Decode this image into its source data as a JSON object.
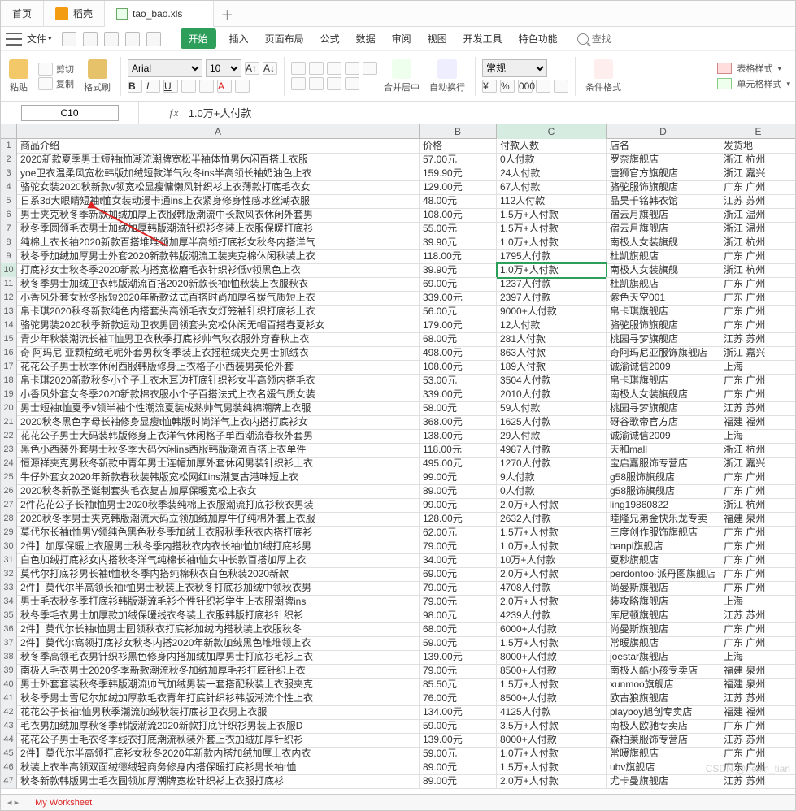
{
  "tabs": [
    {
      "label": "首页",
      "icon": false
    },
    {
      "label": "稻壳",
      "icon": true
    },
    {
      "label": "tao_bao.xls",
      "icon": true
    }
  ],
  "menu": {
    "file": "文件",
    "items": [
      "开始",
      "插入",
      "页面布局",
      "公式",
      "数据",
      "审阅",
      "视图",
      "开发工具",
      "特色功能"
    ],
    "search": "查找"
  },
  "ribbon": {
    "paste": "粘贴",
    "cut": "剪切",
    "copy": "复制",
    "format_painter": "格式刷",
    "font": "Arial",
    "size": "10",
    "merge": "合并居中",
    "wrap": "自动换行",
    "general": "常规",
    "cond_format": "条件格式",
    "table_styles": "表格样式",
    "cell_styles": "单元格样式"
  },
  "namebox": "C10",
  "formula": "1.0万+人付款",
  "cols": [
    "",
    "A",
    "B",
    "C",
    "D",
    "E"
  ],
  "header": [
    "商品介绍",
    "价格",
    "付款人数",
    "店名",
    "发货地"
  ],
  "rows": [
    [
      "2020新款夏季男士短袖t恤潮流潮牌宽松半袖体恤男休闲百搭上衣服",
      "57.00元",
      "0人付款",
      "罗奈旗舰店",
      "浙江 杭州"
    ],
    [
      "yoe卫衣温柔风宽松韩版加绒短款洋气秋冬ins半高领长袖奶油色上衣",
      "159.90元",
      "24人付款",
      "唐狮官方旗舰店",
      "浙江 嘉兴"
    ],
    [
      "骆驼女装2020秋新款v领宽松显瘦慵懒风针织衫上衣薄款打底毛衣女",
      "129.00元",
      "67人付款",
      "骆驼服饰旗舰店",
      "广东 广州"
    ],
    [
      "日系3d大眼睛短袖t恤女装动漫卡通ins上衣紧身修身性感冰丝潮衣服",
      "48.00元",
      "112人付款",
      "品昊千铭韩衣馆",
      "江苏 苏州"
    ],
    [
      "男士夹克秋冬季新款加绒加厚上衣服韩版潮流中长款风衣休闲外套男",
      "108.00元",
      "1.5万+人付款",
      "宿云月旗舰店",
      "浙江 温州"
    ],
    [
      "秋冬季圆领毛衣男士加绒加厚韩版潮流针织衫冬装上衣服保暖打底衫",
      "55.00元",
      "1.5万+人付款",
      "宿云月旗舰店",
      "浙江 温州"
    ],
    [
      "纯棉上衣长袖2020新款百搭堆堆领加厚半高领打底衫女秋冬内搭洋气",
      "39.90元",
      "1.0万+人付款",
      "南极人女装旗舰",
      "浙江 杭州"
    ],
    [
      "秋冬季加绒加厚男士外套2020新款韩版潮流工装夹克棉休闲秋装上衣",
      "118.00元",
      "1795人付款",
      "杜凯旗舰店",
      "广东 广州"
    ],
    [
      "打底衫女士秋冬季2020新款内搭宽松磨毛衣针织衫低v领黑色上衣",
      "39.90元",
      "1.0万+人付款",
      "南极人女装旗舰",
      "浙江 杭州"
    ],
    [
      "秋冬季男士加绒卫衣韩版潮流百搭2020新款长袖t恤秋装上衣服秋衣",
      "69.00元",
      "1237人付款",
      "杜凯旗舰店",
      "广东 广州"
    ],
    [
      "小香风外套女秋冬服短2020年新款法式百搭时尚加厚名媛气质短上衣",
      "339.00元",
      "2397人付款",
      "紫色天空001",
      "广东 广州"
    ],
    [
      "帛卡琪2020秋冬新款纯色内搭套头高领毛衣女灯笼袖针织打底衫上衣",
      "56.00元",
      "9000+人付款",
      "帛卡琪旗舰店",
      "广东 广州"
    ],
    [
      "骆驼男装2020秋季新款运动卫衣男圆领套头宽松休闲无帽百搭春夏衫女",
      "179.00元",
      "12人付款",
      "骆驼服饰旗舰店",
      "广东 广州"
    ],
    [
      "青少年秋装潮流长袖T恤男卫衣秋季打底衫帅气秋衣服外穿春秋上衣",
      "68.00元",
      "281人付款",
      "桃园寻梦旗舰店",
      "江苏 苏州"
    ],
    [
      "奇 阿玛尼 亚颗粒绒毛呢外套男秋冬季装上衣摇粒绒夹克男士抓绒衣",
      "498.00元",
      "863人付款",
      "奇阿玛尼亚服饰旗舰店",
      "浙江 嘉兴"
    ],
    [
      "花花公子男士秋季休闲西服韩版修身上衣格子小西装男英伦外套",
      "108.00元",
      "189人付款",
      "诚渝诚信2009",
      "上海"
    ],
    [
      "帛卡琪2020新款秋冬小个子上衣木耳边打底针织衫女半高领内搭毛衣",
      "53.00元",
      "3504人付款",
      "帛卡琪旗舰店",
      "广东 广州"
    ],
    [
      "小香风外套女冬季2020新款棉衣服小个子百搭法式上衣名媛气质女装",
      "339.00元",
      "2010人付款",
      "南极人女装旗舰店",
      "广东 广州"
    ],
    [
      "男士短袖t恤夏季v领半袖个性潮流夏装成熟帅气男装纯棉潮牌上衣服",
      "58.00元",
      "59人付款",
      "桃园寻梦旗舰店",
      "江苏 苏州"
    ],
    [
      "2020秋冬黑色字母长袖修身显瘦t恤韩版时尚洋气上衣内搭打底衫女",
      "368.00元",
      "1625人付款",
      "砑谷歌帝官方店",
      "福建 福州"
    ],
    [
      "花花公子男士大码装韩版修身上衣洋气休闲格子单西潮流春秋外套男",
      "138.00元",
      "29人付款",
      "诚渝诚信2009",
      "上海"
    ],
    [
      "黑色小西装外套男士秋冬季大码休闲ins西服韩版潮流百搭上衣单件",
      "118.00元",
      "4987人付款",
      "天和mall",
      "浙江 杭州"
    ],
    [
      "恒源祥夹克男秋冬新款中青年男士连帽加厚外套休闲男装针织衫上衣",
      "495.00元",
      "1270人付款",
      "宝启嘉服饰专营店",
      "浙江 嘉兴"
    ],
    [
      "牛仔外套女2020年新款春秋装韩版宽松网红ins潮复古港味短上衣",
      "99.00元",
      "9人付款",
      "g58服饰旗舰店",
      "广东 广州"
    ],
    [
      "2020秋冬新款圣诞制套头毛衣复古加厚保暖宽松上衣女",
      "89.00元",
      "0人付款",
      "g58服饰旗舰店",
      "广东 广州"
    ],
    [
      "2件花花公子长袖t恤男士2020秋季装纯棉上衣服潮流打底衫秋衣男装",
      "99.00元",
      "2.0万+人付款",
      "ling19860822",
      "浙江 杭州"
    ],
    [
      "2020秋冬季男士夹克韩版潮流大码立领加绒加厚牛仔纯棉外套上衣服",
      "128.00元",
      "2632人付款",
      "睦隆兄弟金快乐龙专卖",
      "福建 泉州"
    ],
    [
      "莫代尔长袖t恤男V领纯色黑色秋冬季加绒上衣服秋季秋衣内搭打底衫",
      "62.00元",
      "1.5万+人付款",
      "三度创作服饰旗舰店",
      "广东 广州"
    ],
    [
      "2件】加厚保暖上衣服男士秋冬季内搭秋衣内衣长袖t恤加绒打底衫男",
      "79.00元",
      "1.0万+人付款",
      "banpi旗舰店",
      "广东 广州"
    ],
    [
      "白色加绒打底衫女内搭秋冬洋气纯棉长袖t恤女中长款百搭加厚上衣",
      "34.00元",
      "10万+人付款",
      "夏秒旗舰店",
      "广东 广州"
    ],
    [
      "莫代尔打底衫男长袖t恤秋冬季内搭纯棉秋衣白色秋装2020新款",
      "69.00元",
      "2.0万+人付款",
      "perdontoo·派丹图旗舰店",
      "广东 广州"
    ],
    [
      "2件】莫代尔半高领长袖t恤男士秋装上衣秋冬打底衫加绒中领秋衣男",
      "79.00元",
      "4708人付款",
      "尚曼斯旗舰店",
      "广东 广州"
    ],
    [
      "男士毛衣秋冬季打底衫韩版潮流毛衫个性针织衫学生上衣服潮牌ins",
      "79.00元",
      "2.0万+人付款",
      "装攻略旗舰店",
      "上海"
    ],
    [
      "秋冬季毛衣男士加厚款加绒保暖线衣冬装上衣服韩版打底衫针织衫",
      "98.00元",
      "4239人付款",
      "库尼顿旗舰店",
      "江苏 苏州"
    ],
    [
      "2件】莫代尔长袖t恤男士圆领秋衣打底衫加绒内搭秋装上衣服秋冬",
      "68.00元",
      "6000+人付款",
      "尚曼斯旗舰店",
      "广东 广州"
    ],
    [
      "2件】莫代尔高领打底衫女秋冬内搭2020年新款加绒黑色堆堆领上衣",
      "59.00元",
      "1.5万+人付款",
      "常暖旗舰店",
      "广东 广州"
    ],
    [
      "秋冬季高领毛衣男针织衫黑色修身内搭加绒加厚男士打底衫毛衫上衣",
      "139.00元",
      "8000+人付款",
      "joestar旗舰店",
      "上海"
    ],
    [
      "南极人毛衣男士2020冬季新款潮流秋冬加绒加厚毛衫打底针织上衣",
      "79.00元",
      "8500+人付款",
      "南极人酷小孩专卖店",
      "福建 泉州"
    ],
    [
      "男士外套套装秋冬季韩版潮流帅气加绒男装一套搭配秋装上衣服夹克",
      "85.50元",
      "1.5万+人付款",
      "xunmoo旗舰店",
      "福建 泉州"
    ],
    [
      "秋冬季男士雪尼尔加绒加厚款毛衣青年打底针织衫韩版潮流个性上衣",
      "76.00元",
      "8500+人付款",
      "欧古狼旗舰店",
      "江苏 苏州"
    ],
    [
      "花花公子长袖t恤男秋季潮流加绒秋装打底衫卫衣男上衣服",
      "134.00元",
      "4125人付款",
      "playboy旭创专卖店",
      "福建 福州"
    ],
    [
      "毛衣男加绒加厚秋冬季韩版潮流2020新款打底针织衫男装上衣服D",
      "59.00元",
      "3.5万+人付款",
      "南极人欧驰专卖店",
      "广东 广州"
    ],
    [
      "花花公子男士毛衣冬季线衣打底潮流秋装外套上衣加绒加厚针织衫",
      "139.00元",
      "8000+人付款",
      "森柏莱服饰专营店",
      "江苏 苏州"
    ],
    [
      "2件】莫代尔半高领打底衫女秋冬2020年新款内搭加绒加厚上衣内衣",
      "59.00元",
      "1.0万+人付款",
      "常暖旗舰店",
      "广东 广州"
    ],
    [
      "秋装上衣半高领双面绒德绒轻商务修身内搭保暖打底衫男长袖t恤",
      "89.00元",
      "1.5万+人付款",
      "ubv旗舰店",
      "广东 广州"
    ],
    [
      "秋冬新款韩版男士毛衣圆领加厚潮牌宽松针织衫上衣服打底衫",
      "89.00元",
      "2.0万+人付款",
      "尤卡曼旗舰店",
      "江苏 苏州"
    ]
  ],
  "active_cell": {
    "row": 10,
    "col": 3
  },
  "sheettab": "My Worksheet",
  "watermark": "CSDN @hexin_tian"
}
